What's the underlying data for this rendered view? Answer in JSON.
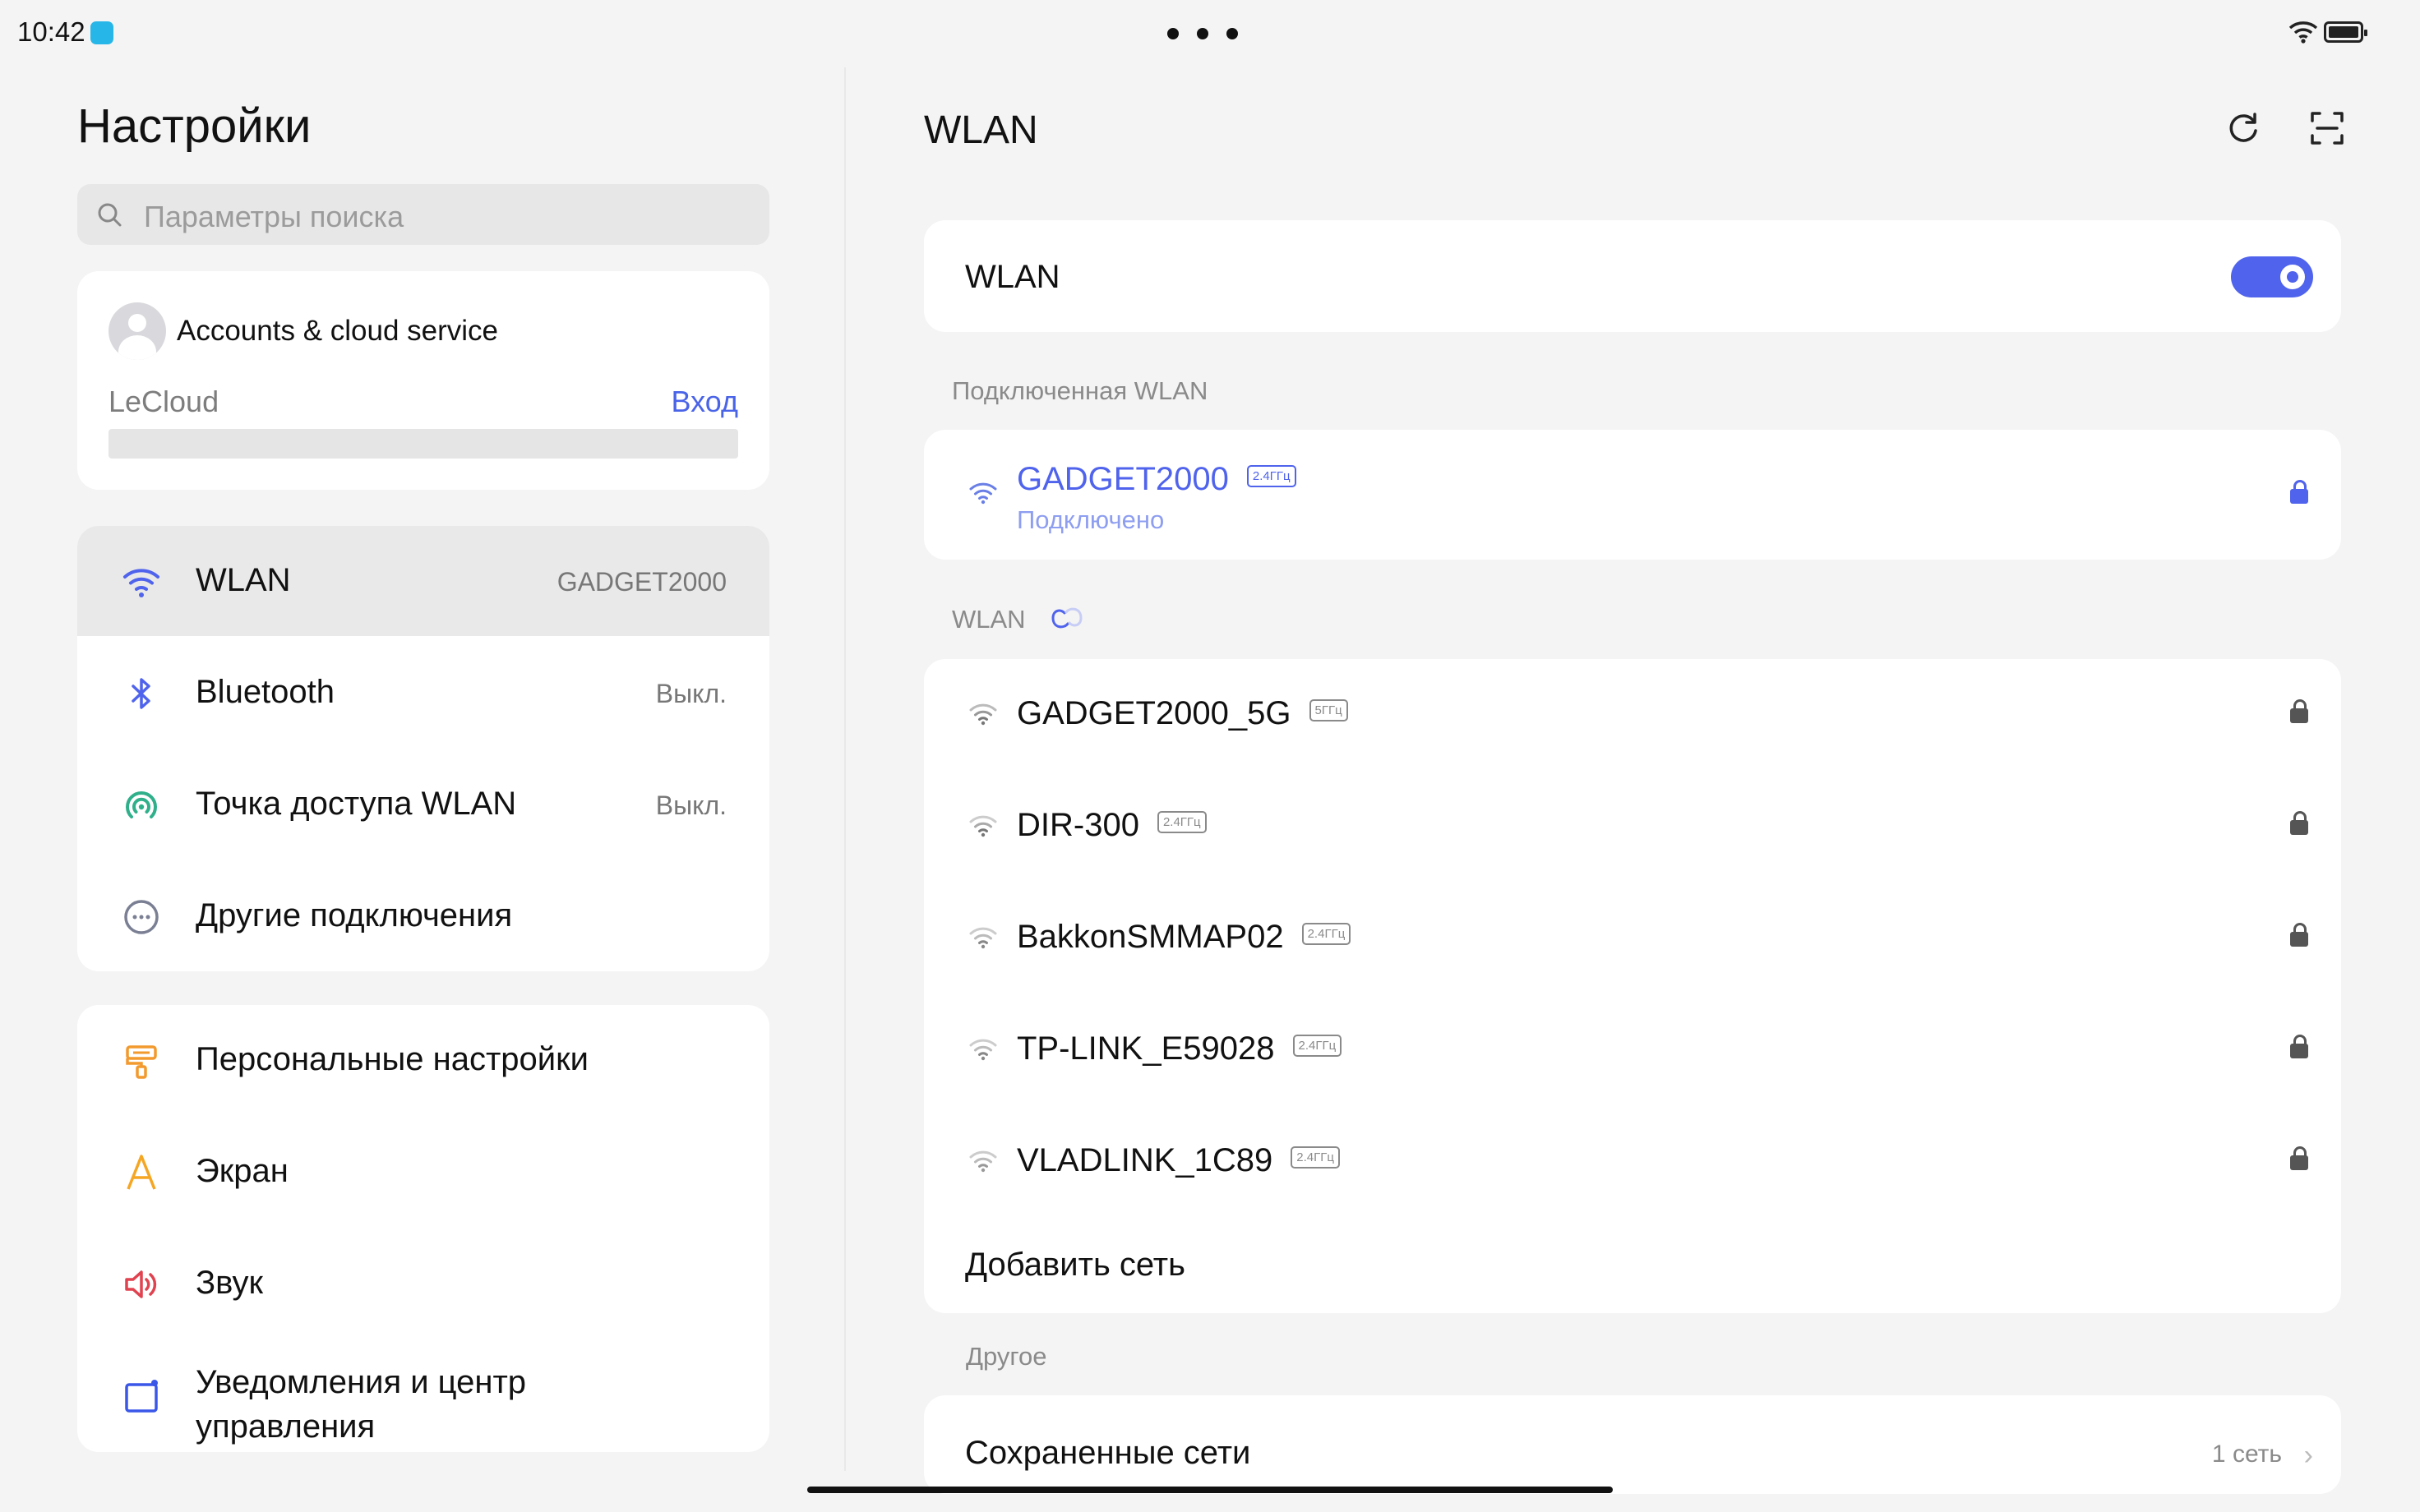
{
  "status_bar": {
    "time": "10:42"
  },
  "left": {
    "title": "Настройки",
    "search": {
      "placeholder": "Параметры поиска"
    },
    "account": {
      "title": "Accounts & cloud service",
      "service": "LeCloud",
      "login": "Вход"
    },
    "connectivity": [
      {
        "icon": "wifi-icon",
        "label": "WLAN",
        "value": "GADGET2000",
        "selected": true
      },
      {
        "icon": "bluetooth-icon",
        "label": "Bluetooth",
        "value": "Выкл."
      },
      {
        "icon": "hotspot-icon",
        "label": "Точка доступа WLAN",
        "value": "Выкл."
      },
      {
        "icon": "more-connections-icon",
        "label": "Другие подключения",
        "value": ""
      }
    ],
    "personal": [
      {
        "icon": "paint-roller-icon",
        "label": "Персональные настройки"
      },
      {
        "icon": "display-letter-a-icon",
        "label": "Экран"
      },
      {
        "icon": "speaker-icon",
        "label": "Звук"
      },
      {
        "icon": "notification-panel-icon",
        "label": "Уведомления и центр управления"
      }
    ]
  },
  "right": {
    "title": "WLAN",
    "wlan_toggle": {
      "label": "WLAN",
      "on": true
    },
    "connected_section": "Подключенная WLAN",
    "connected": {
      "name": "GADGET2000",
      "band": "2.4ГГц",
      "status": "Подключено"
    },
    "available_section": "WLAN",
    "networks": [
      {
        "name": "GADGET2000_5G",
        "band": "5ГГц"
      },
      {
        "name": "DIR-300",
        "band": "2.4ГГц"
      },
      {
        "name": "BakkonSMMAP02",
        "band": "2.4ГГц"
      },
      {
        "name": "TP-LINK_E59028",
        "band": "2.4ГГц"
      },
      {
        "name": "VLADLINK_1C89",
        "band": "2.4ГГц"
      }
    ],
    "add_network": "Добавить сеть",
    "other_section": "Другое",
    "saved": {
      "label": "Сохраненные сети",
      "value": "1 сеть"
    }
  },
  "colors": {
    "accent": "#4f63ec",
    "link": "#4a64e8",
    "connected_text": "#6a7fe6",
    "background": "#f4f4f4"
  }
}
